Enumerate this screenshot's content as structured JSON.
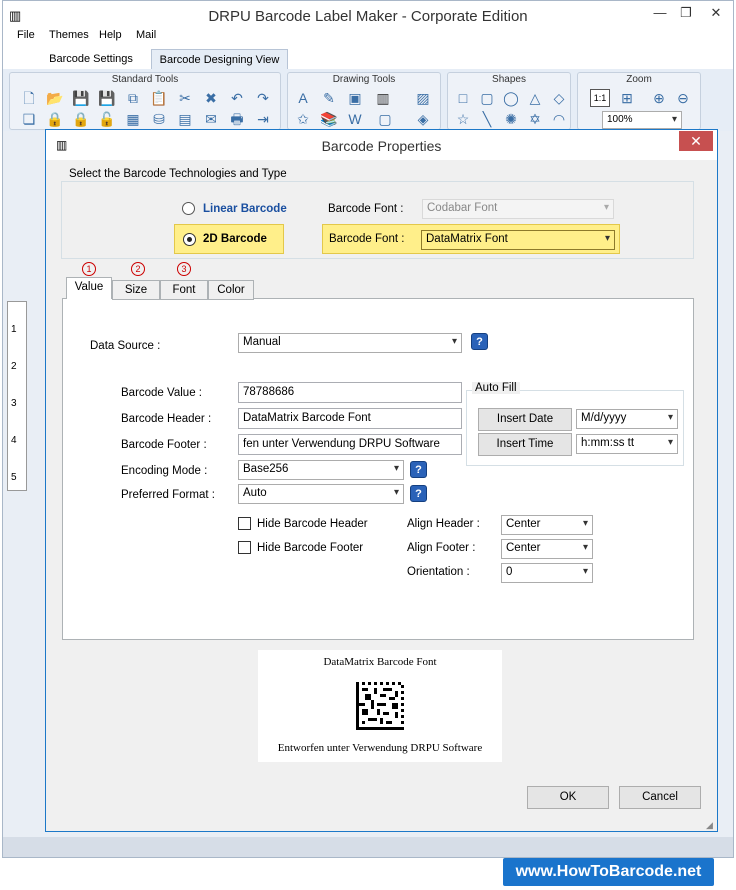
{
  "window": {
    "title": "DRPU Barcode Label Maker - Corporate Edition"
  },
  "menu": [
    "File",
    "Themes",
    "Help",
    "Mail"
  ],
  "ribbon_tabs": [
    "Barcode Settings",
    "Barcode Designing View"
  ],
  "ribbon_groups": {
    "standard": "Standard Tools",
    "drawing": "Drawing Tools",
    "shapes": "Shapes",
    "zoom": "Zoom"
  },
  "zoom": {
    "one_to_one": "1:1",
    "level": "100%"
  },
  "ruler": [
    "1",
    "2",
    "3",
    "4",
    "5"
  ],
  "dialog": {
    "title": "Barcode Properties",
    "close": "✕",
    "tech_legend": "Select the Barcode Technologies and Type",
    "linear_label": "Linear Barcode",
    "twod_label": "2D Barcode",
    "font_label": "Barcode Font :",
    "linear_font": "Codabar Font",
    "twod_font": "DataMatrix Font",
    "tabs": [
      "Value",
      "Size",
      "Font",
      "Color"
    ],
    "tab_numbers": [
      "1",
      "2",
      "3"
    ],
    "data_source_label": "Data Source :",
    "data_source": "Manual",
    "barcode_value_label": "Barcode Value :",
    "barcode_value": "78788686",
    "barcode_header_label": "Barcode Header :",
    "barcode_header": "DataMatrix Barcode Font",
    "barcode_footer_label": "Barcode Footer :",
    "barcode_footer": "fen unter Verwendung DRPU Software",
    "encoding_label": "Encoding Mode :",
    "encoding": "Base256",
    "format_label": "Preferred Format :",
    "format": "Auto",
    "autofill_legend": "Auto Fill",
    "insert_date": "Insert Date",
    "date_format": "M/d/yyyy",
    "insert_time": "Insert Time",
    "time_format": "h:mm:ss tt",
    "hide_header": "Hide Barcode Header",
    "hide_footer": "Hide Barcode Footer",
    "align_header_label": "Align Header :",
    "align_header": "Center",
    "align_footer_label": "Align Footer :",
    "align_footer": "Center",
    "orientation_label": "Orientation :",
    "orientation": "0",
    "preview_header": "DataMatrix Barcode Font",
    "preview_footer": "Entworfen unter Verwendung DRPU Software",
    "ok": "OK",
    "cancel": "Cancel",
    "help": "?"
  },
  "banner": "www.HowToBarcode.net"
}
